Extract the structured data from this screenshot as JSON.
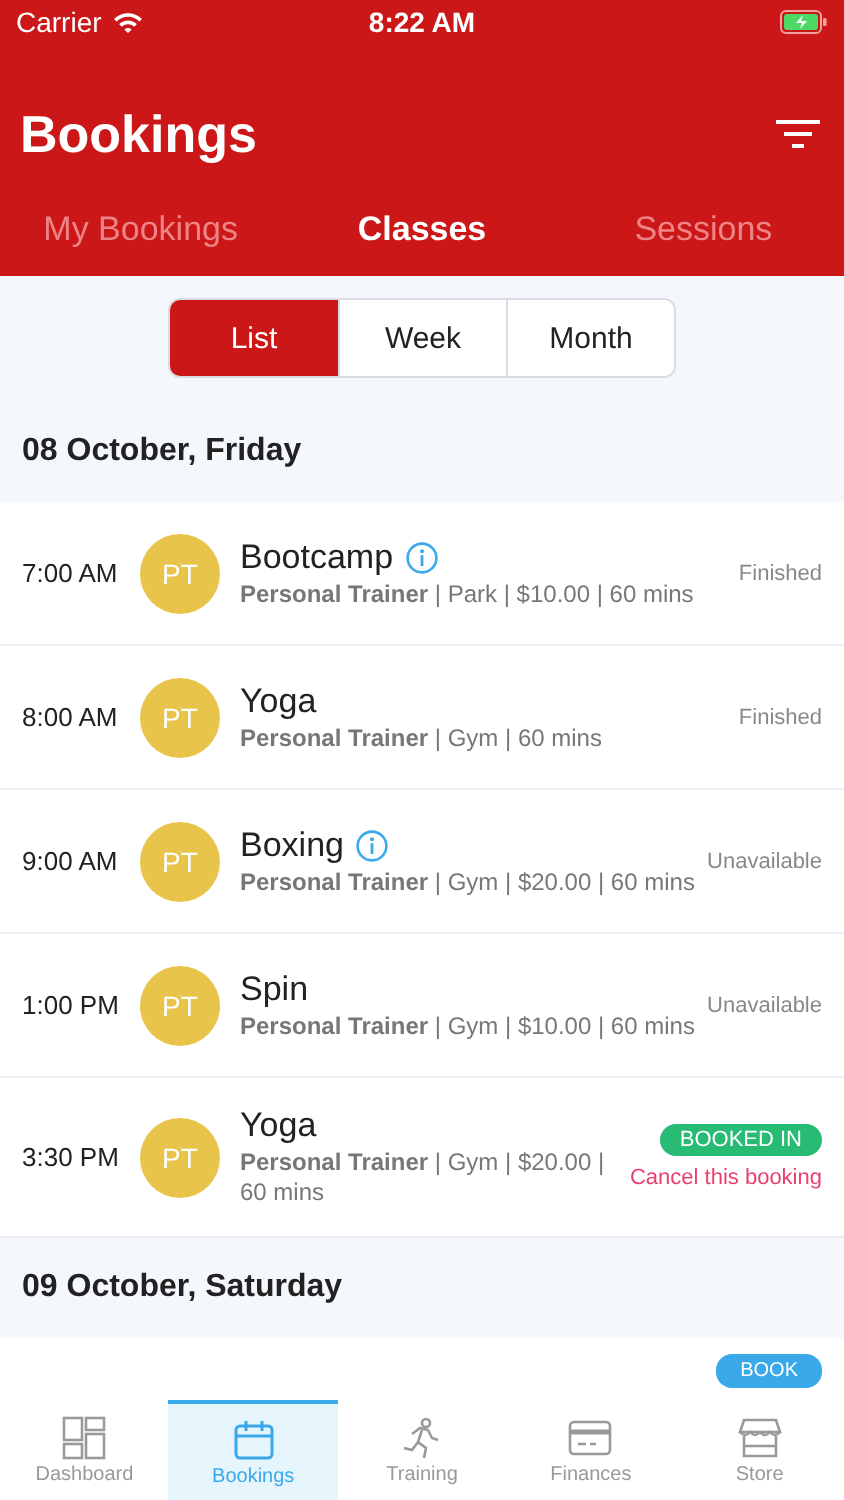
{
  "status_bar": {
    "carrier": "Carrier",
    "time": "8:22 AM"
  },
  "header": {
    "title": "Bookings"
  },
  "tabs": [
    {
      "label": "My Bookings",
      "selected": false
    },
    {
      "label": "Classes",
      "selected": true
    },
    {
      "label": "Sessions",
      "selected": false
    }
  ],
  "view_switch": [
    {
      "label": "List",
      "selected": true
    },
    {
      "label": "Week",
      "selected": false
    },
    {
      "label": "Month",
      "selected": false
    }
  ],
  "days": [
    {
      "date": "08 October, Friday",
      "classes": [
        {
          "time": "7:00 AM",
          "avatar": "PT",
          "name": "Bootcamp",
          "info": true,
          "details": "**Personal Trainer** | Park | $10.00 | 60 mins",
          "status": {
            "kind": "text",
            "label": "Finished"
          }
        },
        {
          "time": "8:00 AM",
          "avatar": "PT",
          "name": "Yoga",
          "info": false,
          "details": "**Personal Trainer** | Gym | 60 mins",
          "status": {
            "kind": "text",
            "label": "Finished"
          }
        },
        {
          "time": "9:00 AM",
          "avatar": "PT",
          "name": "Boxing",
          "info": true,
          "details": "**Personal Trainer** | Gym | $20.00 | 60 mins",
          "status": {
            "kind": "text",
            "label": "Unavailable"
          }
        },
        {
          "time": "1:00 PM",
          "avatar": "PT",
          "name": "Spin",
          "info": false,
          "details": "**Personal Trainer** | Gym | $10.00 | 60 mins",
          "status": {
            "kind": "text",
            "label": "Unavailable"
          }
        },
        {
          "time": "3:30 PM",
          "avatar": "PT",
          "name": "Yoga",
          "info": false,
          "details": "**Personal Trainer** | Gym | $20.00 | 60 mins",
          "status": {
            "kind": "booked",
            "label": "BOOKED IN",
            "cancel": "Cancel this booking"
          }
        }
      ]
    },
    {
      "date": "09 October, Saturday",
      "classes": [
        {
          "status": {
            "kind": "button",
            "label": "BOOK"
          }
        }
      ]
    }
  ],
  "nav": [
    {
      "label": "Dashboard",
      "selected": false
    },
    {
      "label": "Bookings",
      "selected": true
    },
    {
      "label": "Training",
      "selected": false
    },
    {
      "label": "Finances",
      "selected": false
    },
    {
      "label": "Store",
      "selected": false
    }
  ]
}
